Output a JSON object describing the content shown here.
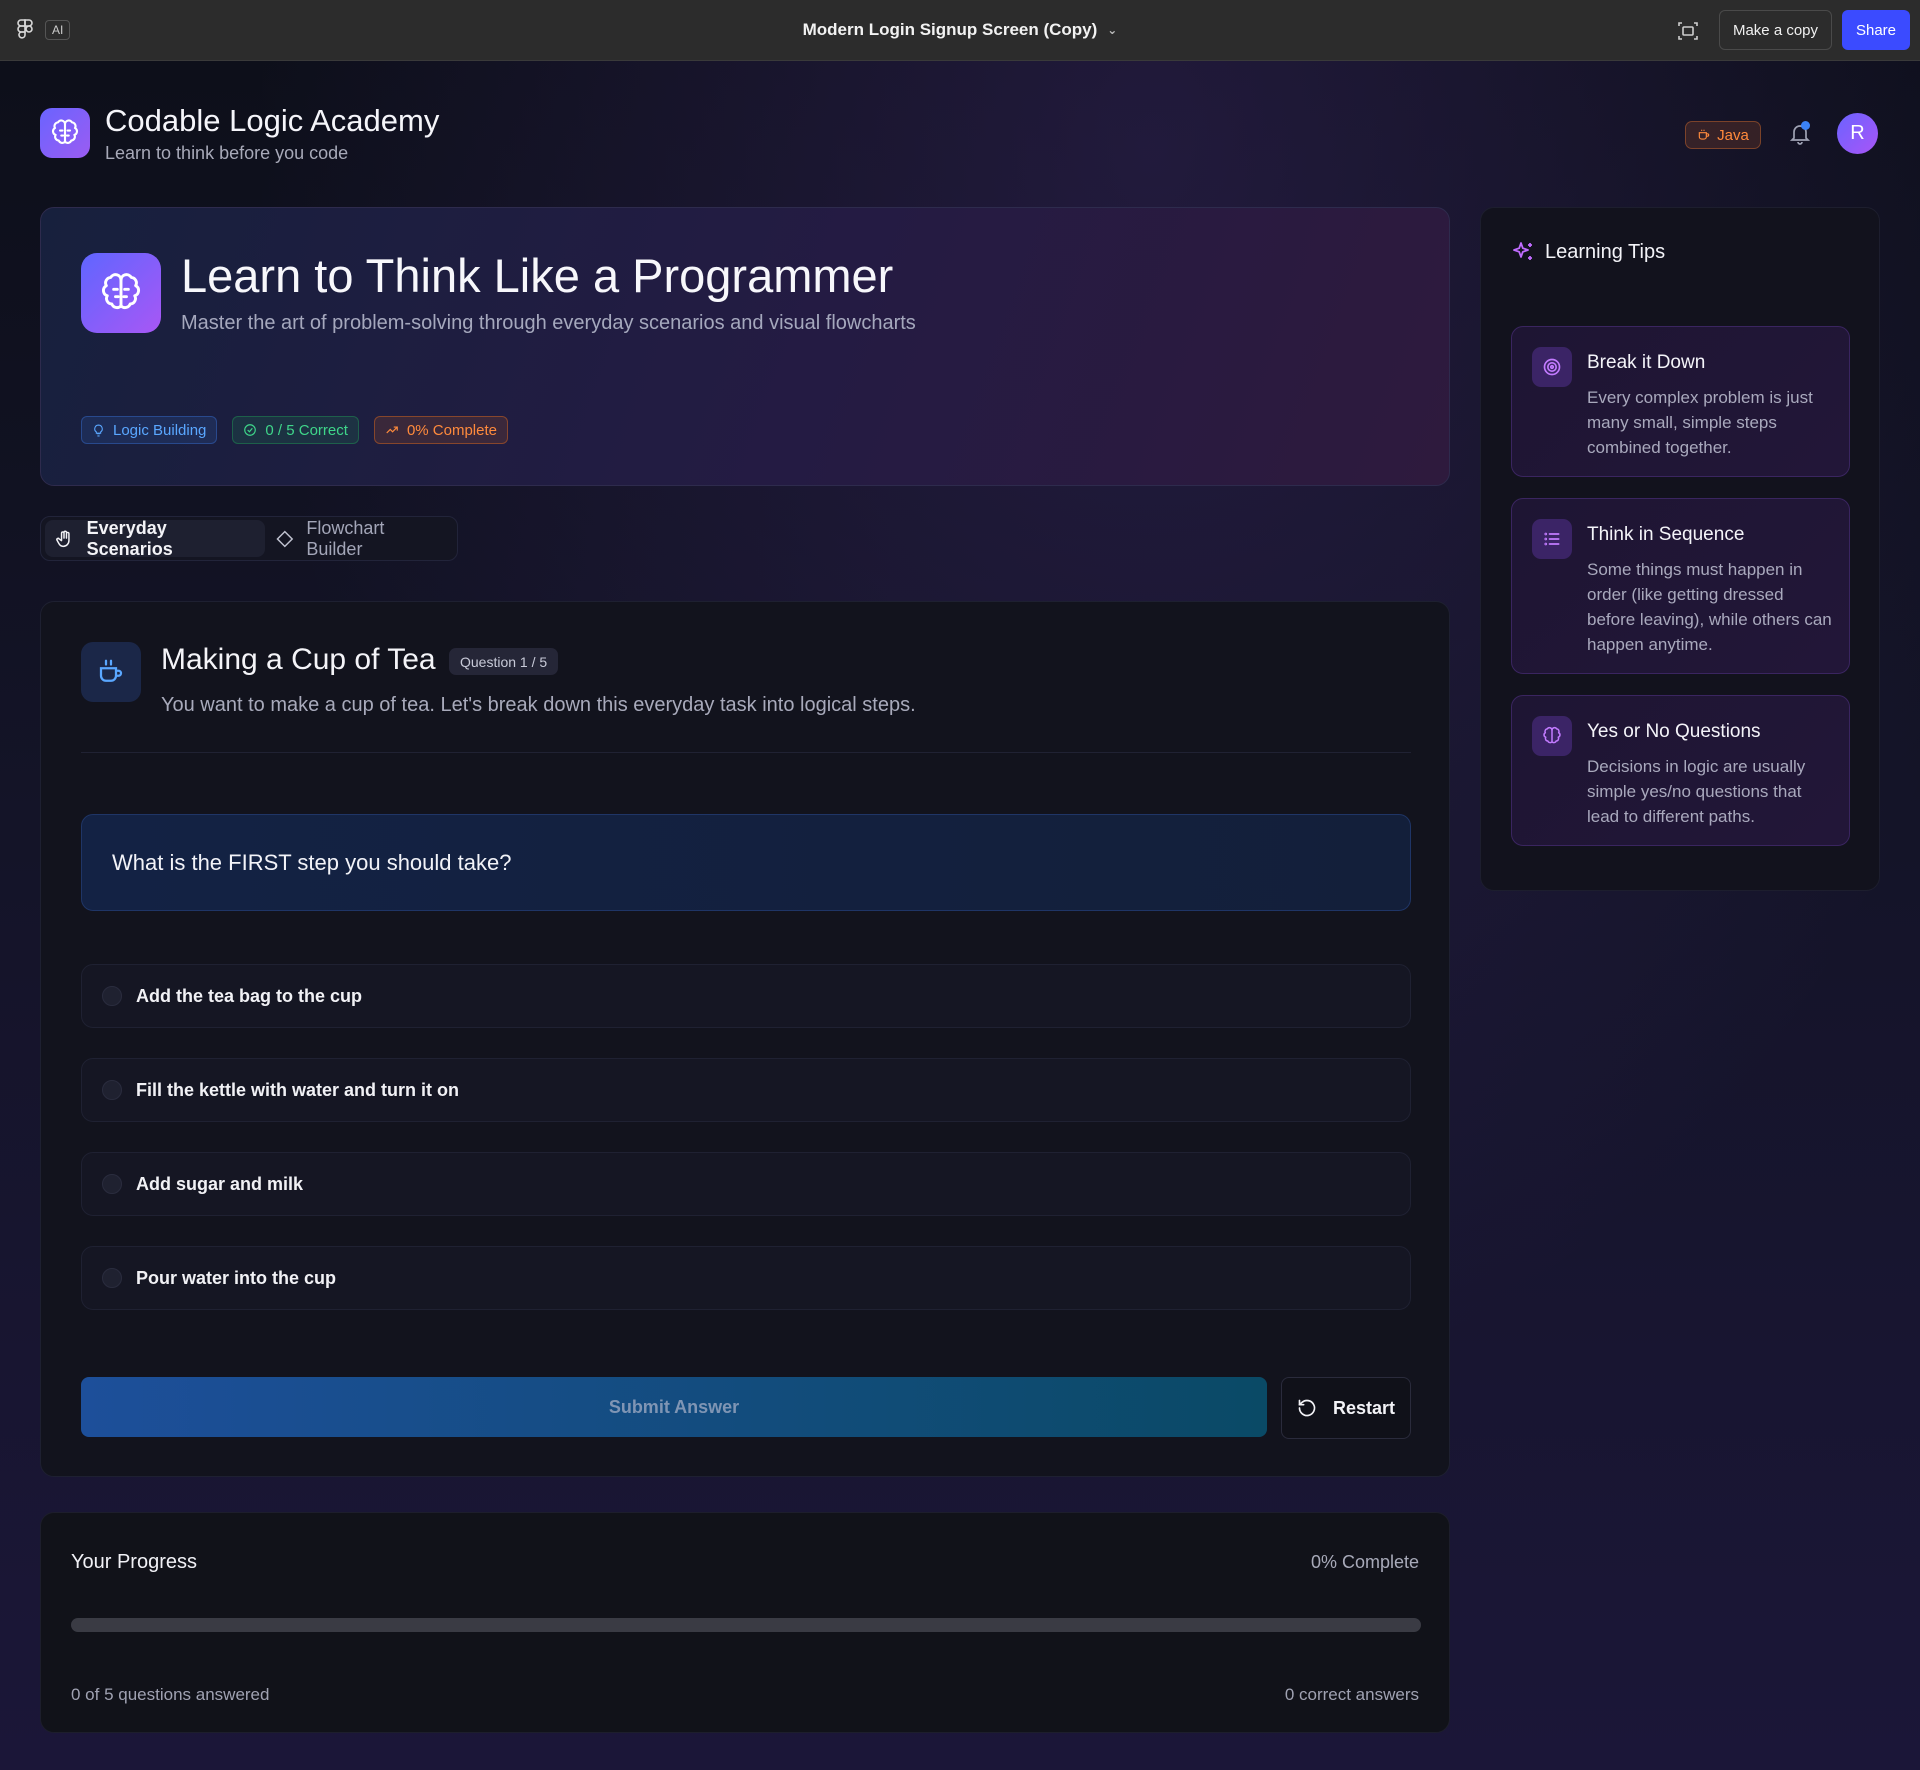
{
  "toolbar": {
    "ai_label": "AI",
    "file_title": "Modern Login Signup Screen (Copy)",
    "make_copy_label": "Make a copy",
    "share_label": "Share"
  },
  "brand": {
    "name": "Codable Logic Academy",
    "tagline": "Learn to think before you code"
  },
  "header": {
    "language_badge": "Java",
    "avatar_initial": "R"
  },
  "hero": {
    "title": "Learn to Think Like a Programmer",
    "subtitle": "Master the art of problem-solving through everyday scenarios and visual flowcharts",
    "chips": [
      "Logic Building",
      "0 / 5 Correct",
      "0% Complete"
    ]
  },
  "tabs": [
    {
      "label": "Everyday Scenarios",
      "active": true
    },
    {
      "label": "Flowchart Builder",
      "active": false
    }
  ],
  "question": {
    "title": "Making a Cup of Tea",
    "badge": "Question 1 / 5",
    "description": "You want to make a cup of tea. Let's break down this everyday task into logical steps.",
    "prompt": "What is the FIRST step you should take?",
    "options": [
      "Add the tea bag to the cup",
      "Fill the kettle with water and turn it on",
      "Add sugar and milk",
      "Pour water into the cup"
    ],
    "submit_label": "Submit Answer",
    "restart_label": "Restart"
  },
  "progress": {
    "title": "Your Progress",
    "percent_label": "0% Complete",
    "fraction": 0,
    "answered_label": "0 of 5 questions answered",
    "correct_label": "0 correct answers"
  },
  "tips": {
    "heading": "Learning Tips",
    "items": [
      {
        "title": "Break it Down",
        "text": "Every complex problem is just many small, simple steps combined together.",
        "icon": "target-icon"
      },
      {
        "title": "Think in Sequence",
        "text": "Some things must happen in order (like getting dressed before leaving), while others can happen anytime.",
        "icon": "list-icon"
      },
      {
        "title": "Yes or No Questions",
        "text": "Decisions in logic are usually simple yes/no questions that lead to different paths.",
        "icon": "brain-icon"
      }
    ]
  },
  "colors": {
    "accent_blue": "#3b4bff",
    "brand_gradient_start": "#6a64ff",
    "brand_gradient_end": "#9b5cf2",
    "java_orange": "#ff8a3c",
    "success_green": "#3fd68a"
  }
}
